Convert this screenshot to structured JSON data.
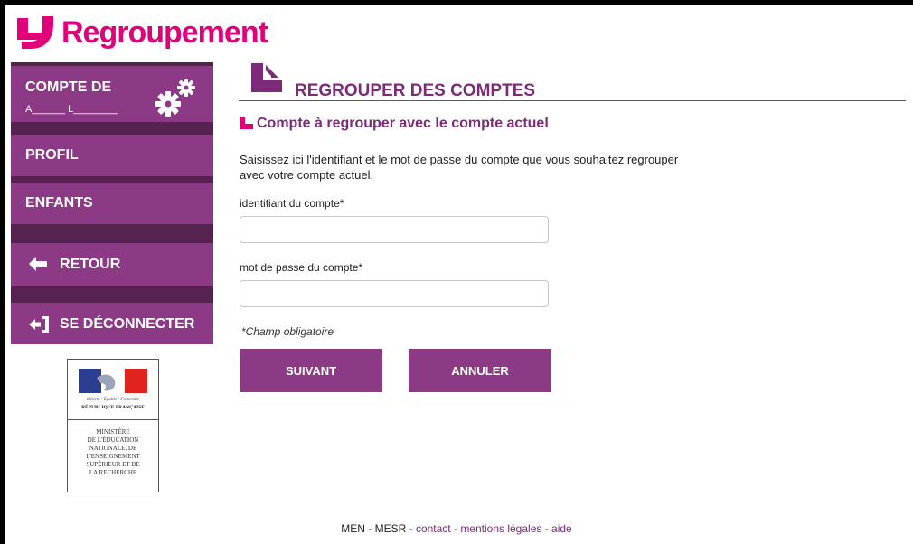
{
  "brand": {
    "name": "Regroupement",
    "color": "#e0007a"
  },
  "sidebar": {
    "account_title": "COMPTE DE",
    "account_name": "A______ L________",
    "items": [
      {
        "label": "PROFIL"
      },
      {
        "label": "ENFANTS"
      }
    ],
    "back_label": "RETOUR",
    "logout_label": "SE DÉCONNECTER"
  },
  "ministry": {
    "motto": "Liberté • Égalité • Fraternité",
    "republic": "RÉPUBLIQUE FRANÇAISE",
    "name": "MINISTÈRE\nDE L'ÉDUCATION\nNATIONALE, DE\nL'ENSEIGNEMENT\nSUPÉRIEUR ET DE\nLA RECHERCHE"
  },
  "main": {
    "title": "REGROUPER DES COMPTES",
    "subtitle": "Compte à regrouper avec le compte actuel",
    "description": "Saisissez ici l'identifiant et le mot de passe du compte que vous souhaitez regrouper avec votre compte actuel.",
    "id_label": "identifiant du compte*",
    "id_value": "",
    "password_label": "mot de passe du compte*",
    "password_value": "",
    "required_note": "*Champ obligatoire",
    "next_label": "SUIVANT",
    "cancel_label": "ANNULER"
  },
  "footer": {
    "men": "MEN",
    "mesr": "MESR",
    "contact": "contact",
    "legal": "mentions légales",
    "help": "aide"
  },
  "colors": {
    "accent": "#8d3a86",
    "accent_dark": "#56224f",
    "title": "#7d2a78"
  }
}
